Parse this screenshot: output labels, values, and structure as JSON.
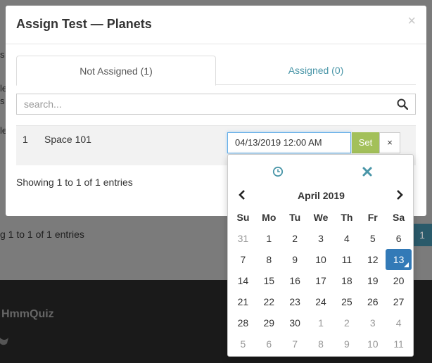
{
  "background": {
    "showing": "g 1 to 1 of 1 entries",
    "page_button": "1",
    "brand": "HmmQuiz"
  },
  "modal": {
    "title": "Assign Test — Planets",
    "close": "×",
    "tabs": [
      {
        "label": "Not Assigned (1)"
      },
      {
        "label": "Assigned (0)"
      }
    ],
    "search_placeholder": "search...",
    "row": {
      "number": "1",
      "name": "Space 101",
      "date_value": "04/13/2019 12:00 AM",
      "set_label": "Set",
      "clear_label": "×"
    },
    "showing": "Showing 1 to 1 of 1 entries"
  },
  "datepicker": {
    "month": "April 2019",
    "weekdays": [
      "Su",
      "Mo",
      "Tu",
      "We",
      "Th",
      "Fr",
      "Sa"
    ],
    "weeks": [
      [
        "31",
        "1",
        "2",
        "3",
        "4",
        "5",
        "6"
      ],
      [
        "7",
        "8",
        "9",
        "10",
        "11",
        "12",
        "13"
      ],
      [
        "14",
        "15",
        "16",
        "17",
        "18",
        "19",
        "20"
      ],
      [
        "21",
        "22",
        "23",
        "24",
        "25",
        "26",
        "27"
      ],
      [
        "28",
        "29",
        "30",
        "1",
        "2",
        "3",
        "4"
      ],
      [
        "5",
        "6",
        "7",
        "8",
        "9",
        "10",
        "11"
      ]
    ],
    "selected": "13",
    "colors": {
      "accent": "#337ab7",
      "set_button": "#a3c05a",
      "tab_link": "#4a96a8"
    }
  }
}
